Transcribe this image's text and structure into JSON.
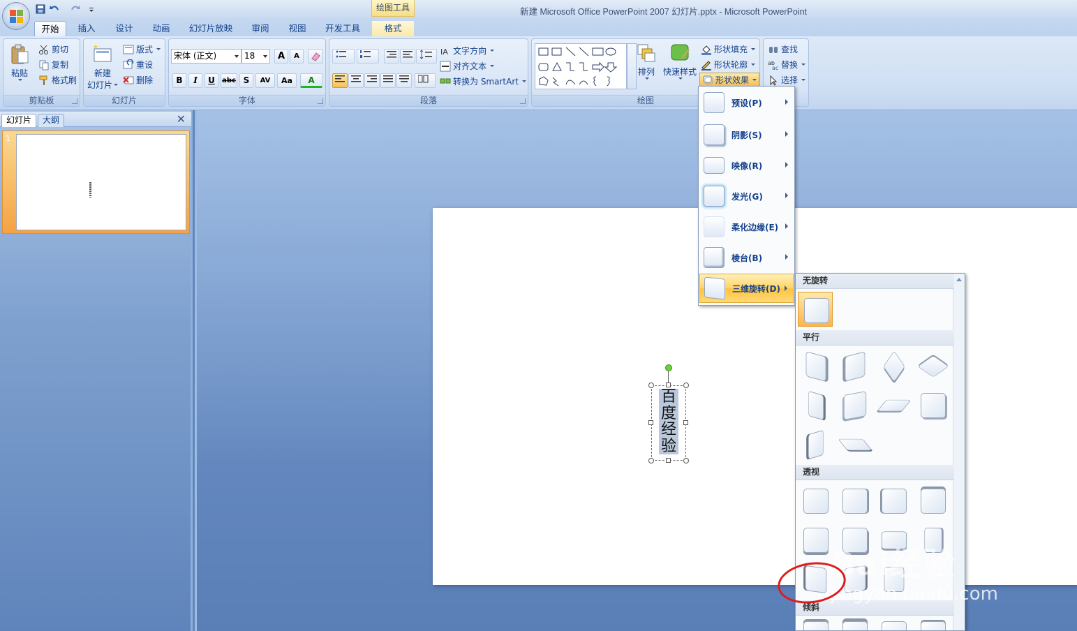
{
  "window": {
    "title": "新建 Microsoft Office PowerPoint 2007 幻灯片.pptx - Microsoft PowerPoint",
    "context_tab_group": "绘图工具"
  },
  "tabs": [
    "开始",
    "插入",
    "设计",
    "动画",
    "幻灯片放映",
    "审阅",
    "视图",
    "开发工具",
    "格式"
  ],
  "ribbon": {
    "clipboard": {
      "paste": "粘贴",
      "cut": "剪切",
      "copy": "复制",
      "format_painter": "格式刷",
      "label": "剪贴板"
    },
    "slides": {
      "new_slide_line1": "新建",
      "new_slide_line2": "幻灯片",
      "layout": "版式",
      "reset": "重设",
      "delete": "删除",
      "label": "幻灯片"
    },
    "font": {
      "font_name": "宋体 (正文)",
      "font_size": "18",
      "grow": "A",
      "shrink": "A",
      "bold": "B",
      "italic": "I",
      "underline": "U",
      "strike": "abc",
      "shadow": "S",
      "spacing": "AV",
      "case": "Aa",
      "color": "A",
      "label": "字体"
    },
    "paragraph": {
      "text_direction": "文字方向",
      "align_text": "对齐文本",
      "smartart": "转换为 SmartArt",
      "label": "段落"
    },
    "drawing": {
      "arrange": "排列",
      "quick_styles": "快速样式",
      "shape_fill": "形状填充",
      "shape_outline": "形状轮廓",
      "shape_effects": "形状效果",
      "label": "绘图"
    },
    "editing": {
      "find": "查找",
      "replace": "替换",
      "select": "选择"
    }
  },
  "panel": {
    "tab_slides": "幻灯片",
    "tab_outline": "大纲",
    "close": "✕",
    "thumb_number": "1"
  },
  "slide": {
    "text": "百度经验"
  },
  "effects_menu": [
    {
      "label": "预设(P)",
      "hot": false
    },
    {
      "label": "阴影(S)",
      "hot": false
    },
    {
      "label": "映像(R)",
      "hot": false
    },
    {
      "label": "发光(G)",
      "hot": false
    },
    {
      "label": "柔化边缘(E)",
      "hot": false
    },
    {
      "label": "棱台(B)",
      "hot": false
    },
    {
      "label": "三维旋转(D)",
      "hot": true
    }
  ],
  "gallery": {
    "sections": [
      "无旋转",
      "平行",
      "透视",
      "倾斜"
    ],
    "counts": {
      "no_rotation": 1,
      "parallel": 10,
      "perspective": 12,
      "oblique": 4
    }
  },
  "watermark": {
    "brand": "Bai经验",
    "url": "jingyan.baidu.com"
  },
  "colors": {
    "ribbon": "#dbe7f7",
    "highlight": "#ffd467",
    "annotation": "#e01b1b"
  }
}
